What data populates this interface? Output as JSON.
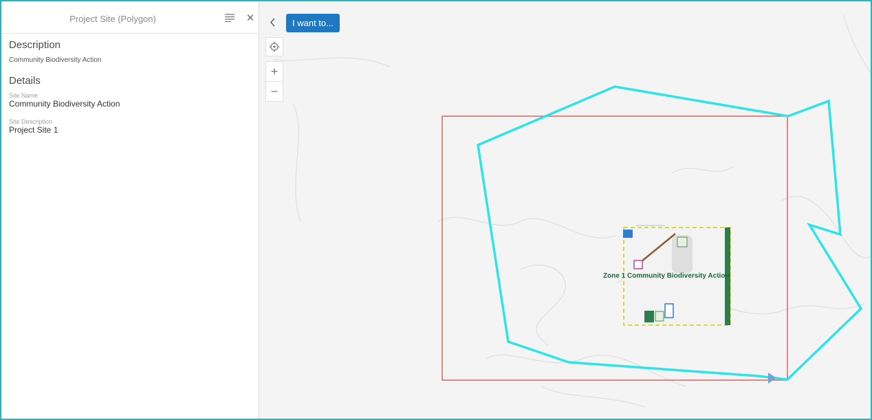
{
  "panel": {
    "title": "Project Site (Polygon)",
    "description_heading": "Description",
    "description_text": "Community Biodiversity Action",
    "details_heading": "Details",
    "fields": [
      {
        "label": "Site Name",
        "value": "Community Biodiversity Action"
      },
      {
        "label": "Site Description",
        "value": "Project Site 1"
      }
    ]
  },
  "toolbar": {
    "i_want_to_label": "I want to..."
  },
  "map": {
    "zone_label": "Zone 1 Community Biodiversity Action",
    "polygon_color": "#2fe3e6",
    "extent_color": "#e06060"
  },
  "icons": {
    "menu": "list-menu-icon",
    "close": "close-icon",
    "collapse": "chevron-left-icon",
    "locate": "locate-icon",
    "zoom_in": "plus-icon",
    "zoom_out": "minus-icon"
  }
}
